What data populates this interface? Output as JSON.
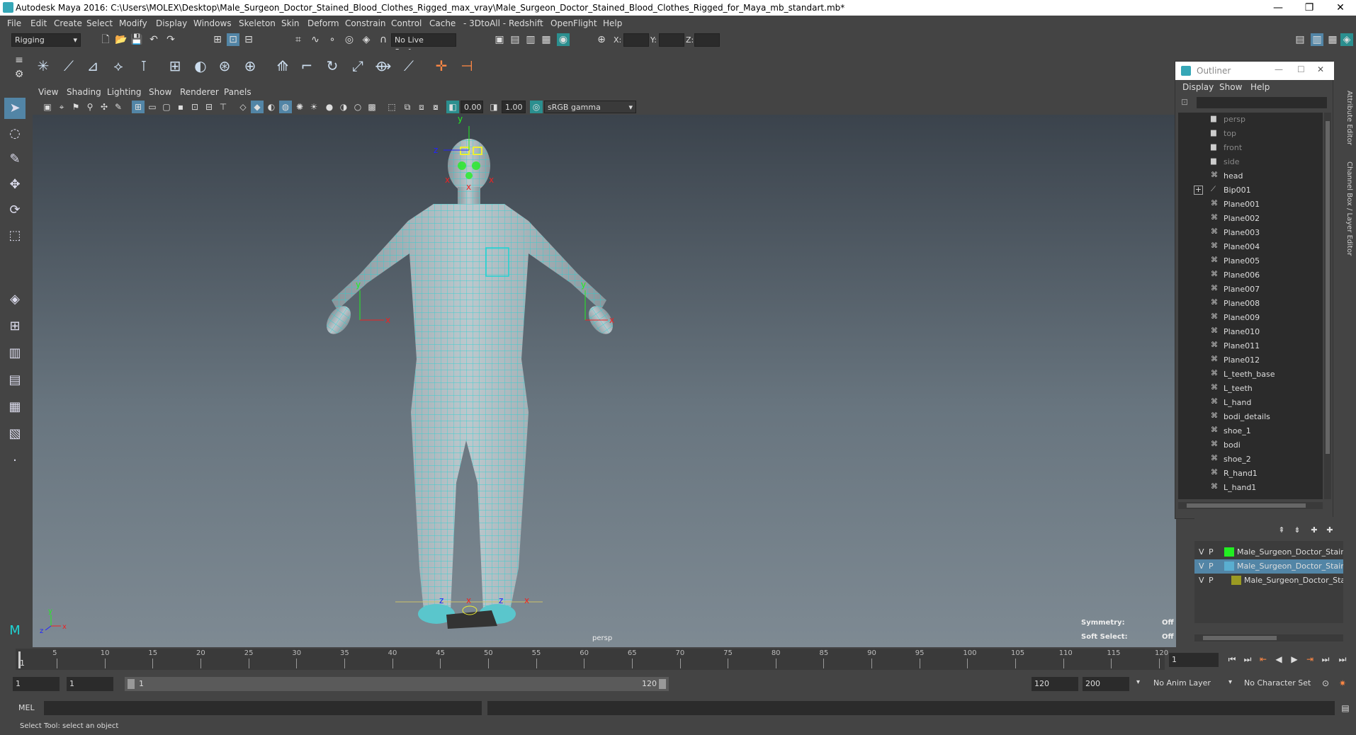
{
  "window": {
    "title": "Autodesk Maya 2016: C:\\Users\\MOLEX\\Desktop\\Male_Surgeon_Doctor_Stained_Blood_Clothes_Rigged_max_vray\\Male_Surgeon_Doctor_Stained_Blood_Clothes_Rigged_for_Maya_mb_standart.mb*",
    "minimize": "—",
    "restore": "❐",
    "close": "✕"
  },
  "menubar": [
    "File",
    "Edit",
    "Create",
    "Select",
    "Modify",
    "Display",
    "Windows",
    "Skeleton",
    "Skin",
    "Deform",
    "Constrain",
    "Control",
    "Cache",
    "- 3DtoAll -",
    "Redshift",
    "OpenFlight",
    "Help"
  ],
  "statusline": {
    "mode": "Rigging",
    "live_surface": "No Live Surface",
    "x_label": "X:",
    "y_label": "Y:",
    "z_label": "Z:"
  },
  "panel": {
    "menus": [
      "View",
      "Shading",
      "Lighting",
      "Show",
      "Renderer",
      "Panels"
    ],
    "exposure": "0.00",
    "gamma": "1.00",
    "color_space": "sRGB gamma",
    "camera_label": "persp",
    "symmetry_label": "Symmetry:",
    "symmetry_value": "Off",
    "soft_select_label": "Soft Select:",
    "soft_select_value": "Off"
  },
  "outliner": {
    "title": "Outliner",
    "menus": [
      "Display",
      "Show",
      "Help"
    ],
    "items": [
      {
        "label": "persp",
        "icon": "camera-icon",
        "dim": true
      },
      {
        "label": "top",
        "icon": "camera-icon",
        "dim": true
      },
      {
        "label": "front",
        "icon": "camera-icon",
        "dim": true
      },
      {
        "label": "side",
        "icon": "camera-icon",
        "dim": true
      },
      {
        "label": "head",
        "icon": "mesh-icon",
        "dim": false
      },
      {
        "label": "Bip001",
        "icon": "joint-icon",
        "dim": false,
        "expandable": true
      },
      {
        "label": "Plane001",
        "icon": "mesh-icon",
        "dim": false
      },
      {
        "label": "Plane002",
        "icon": "mesh-icon",
        "dim": false
      },
      {
        "label": "Plane003",
        "icon": "mesh-icon",
        "dim": false
      },
      {
        "label": "Plane004",
        "icon": "mesh-icon",
        "dim": false
      },
      {
        "label": "Plane005",
        "icon": "mesh-icon",
        "dim": false
      },
      {
        "label": "Plane006",
        "icon": "mesh-icon",
        "dim": false
      },
      {
        "label": "Plane007",
        "icon": "mesh-icon",
        "dim": false
      },
      {
        "label": "Plane008",
        "icon": "mesh-icon",
        "dim": false
      },
      {
        "label": "Plane009",
        "icon": "mesh-icon",
        "dim": false
      },
      {
        "label": "Plane010",
        "icon": "mesh-icon",
        "dim": false
      },
      {
        "label": "Plane011",
        "icon": "mesh-icon",
        "dim": false
      },
      {
        "label": "Plane012",
        "icon": "mesh-icon",
        "dim": false
      },
      {
        "label": "L_teeth_base",
        "icon": "mesh-icon",
        "dim": false
      },
      {
        "label": "L_teeth",
        "icon": "mesh-icon",
        "dim": false
      },
      {
        "label": "L_hand",
        "icon": "mesh-icon",
        "dim": false
      },
      {
        "label": "bodi_details",
        "icon": "mesh-icon",
        "dim": false
      },
      {
        "label": "shoe_1",
        "icon": "mesh-icon",
        "dim": false
      },
      {
        "label": "bodi",
        "icon": "mesh-icon",
        "dim": false
      },
      {
        "label": "shoe_2",
        "icon": "mesh-icon",
        "dim": false
      },
      {
        "label": "R_hand1",
        "icon": "mesh-icon",
        "dim": false
      },
      {
        "label": "L_hand1",
        "icon": "mesh-icon",
        "dim": false
      }
    ]
  },
  "side_tabs": [
    "Attribute Editor",
    "Channel Box / Layer Editor"
  ],
  "layers": [
    {
      "v": "V",
      "p": "P",
      "color": "#22ee22",
      "name": "Male_Surgeon_Doctor_Staine",
      "selected": false
    },
    {
      "v": "V",
      "p": "P",
      "color": "#5aaed0",
      "name": "Male_Surgeon_Doctor_Staine",
      "selected": true
    },
    {
      "v": "V",
      "p": "P",
      "color": "#9a9a22",
      "name": "Male_Surgeon_Doctor_Stai",
      "selected": false
    }
  ],
  "timeline": {
    "ticks": [
      "5",
      "10",
      "15",
      "20",
      "25",
      "30",
      "35",
      "40",
      "45",
      "50",
      "55",
      "60",
      "65",
      "70",
      "75",
      "80",
      "85",
      "90",
      "95",
      "100",
      "105",
      "110",
      "115",
      "120"
    ],
    "start_tick": "1",
    "current_frame": "1"
  },
  "range": {
    "start": "1",
    "anim_start": "1",
    "slider_start": "1",
    "slider_end": "120",
    "anim_end": "120",
    "end": "200",
    "anim_layer": "No Anim Layer",
    "char_set": "No Character Set"
  },
  "cmdline": {
    "label": "MEL"
  },
  "helpline": {
    "text": "Select Tool: select an object"
  },
  "colors": {
    "mesh_wire": "#1fd3d3",
    "accent": "#36a7b7",
    "select_highlight": "#5285a6"
  }
}
